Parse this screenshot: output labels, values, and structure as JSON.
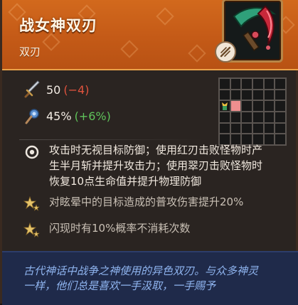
{
  "item": {
    "name": "战女神双刃",
    "type": "双刃",
    "accent_color": "#c45a17"
  },
  "stats": [
    {
      "icon": "sword-icon",
      "value": "50",
      "modifier": "(−4)",
      "modifier_color": "#e0533e"
    },
    {
      "icon": "crit-icon",
      "value": "45%",
      "modifier": "(+6%)",
      "modifier_color": "#5fc35a"
    }
  ],
  "effects": [
    {
      "icon": "target-icon",
      "text_line1": "攻击时无视目标防御；使用红刃击败怪物时产",
      "text_line2": "生半月斩并提升攻击力；使用翠刃击败怪物时",
      "text_line3": "恢复10点生命值并提升物理防御"
    },
    {
      "icon": "star-icon",
      "text": "对眩晕中的目标造成的普攻伤害提升20%"
    },
    {
      "icon": "star-icon",
      "text": "闪现时有10%概率不消耗次数"
    }
  ],
  "flavor": {
    "line1": "古代神话中战争之神使用的异色双刃。与众多神灵",
    "line2": "一样，他们总是喜欢一手汲取，一手赐予"
  }
}
